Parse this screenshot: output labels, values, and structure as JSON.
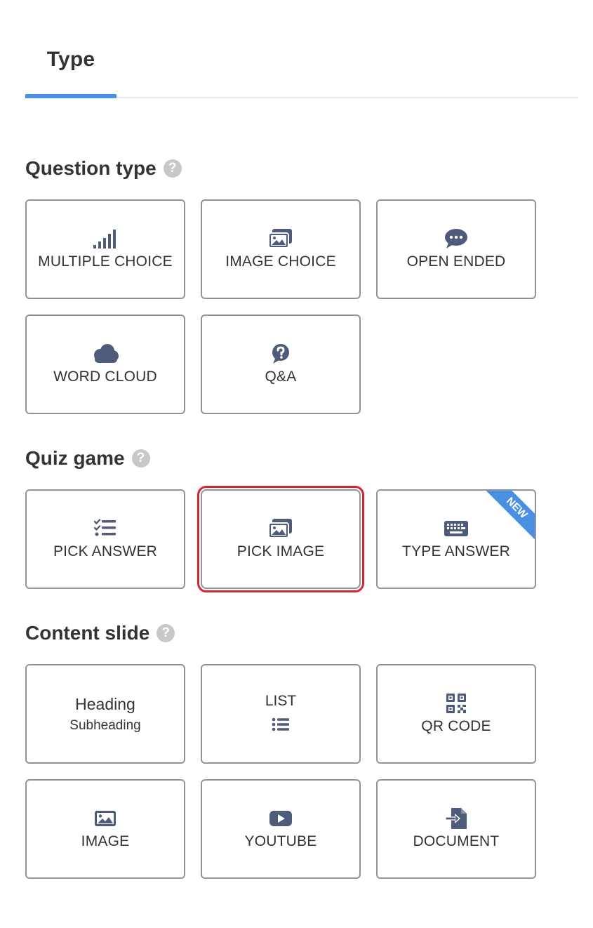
{
  "tab": {
    "label": "Type"
  },
  "sections": {
    "question_type": {
      "title": "Question type",
      "help": "?"
    },
    "quiz_game": {
      "title": "Quiz game",
      "help": "?"
    },
    "content_slide": {
      "title": "Content slide",
      "help": "?"
    }
  },
  "cards": {
    "multiple_choice": {
      "label": "MULTIPLE CHOICE",
      "icon": "bar-chart-icon"
    },
    "image_choice": {
      "label": "IMAGE CHOICE",
      "icon": "images-icon"
    },
    "open_ended": {
      "label": "OPEN ENDED",
      "icon": "speech-bubble-icon"
    },
    "word_cloud": {
      "label": "WORD CLOUD",
      "icon": "cloud-icon"
    },
    "qa": {
      "label": "Q&A",
      "icon": "question-circle-icon"
    },
    "pick_answer": {
      "label": "PICK ANSWER",
      "icon": "checklist-icon"
    },
    "pick_image": {
      "label": "PICK IMAGE",
      "icon": "images-icon"
    },
    "type_answer": {
      "label": "TYPE ANSWER",
      "icon": "keyboard-icon",
      "badge": "NEW"
    },
    "heading": {
      "label": "Heading",
      "sublabel": "Subheading"
    },
    "list": {
      "label": "LIST",
      "icon": "list-icon"
    },
    "qr_code": {
      "label": "QR CODE",
      "icon": "qr-code-icon"
    },
    "image": {
      "label": "IMAGE",
      "icon": "image-icon"
    },
    "youtube": {
      "label": "YOUTUBE",
      "icon": "youtube-icon"
    },
    "document": {
      "label": "DOCUMENT",
      "icon": "document-import-icon"
    }
  },
  "colors": {
    "accent": "#4a90e2",
    "icon": "#4f5b7a",
    "selected_outline": "#d8232a",
    "card_border": "#8f959b"
  }
}
